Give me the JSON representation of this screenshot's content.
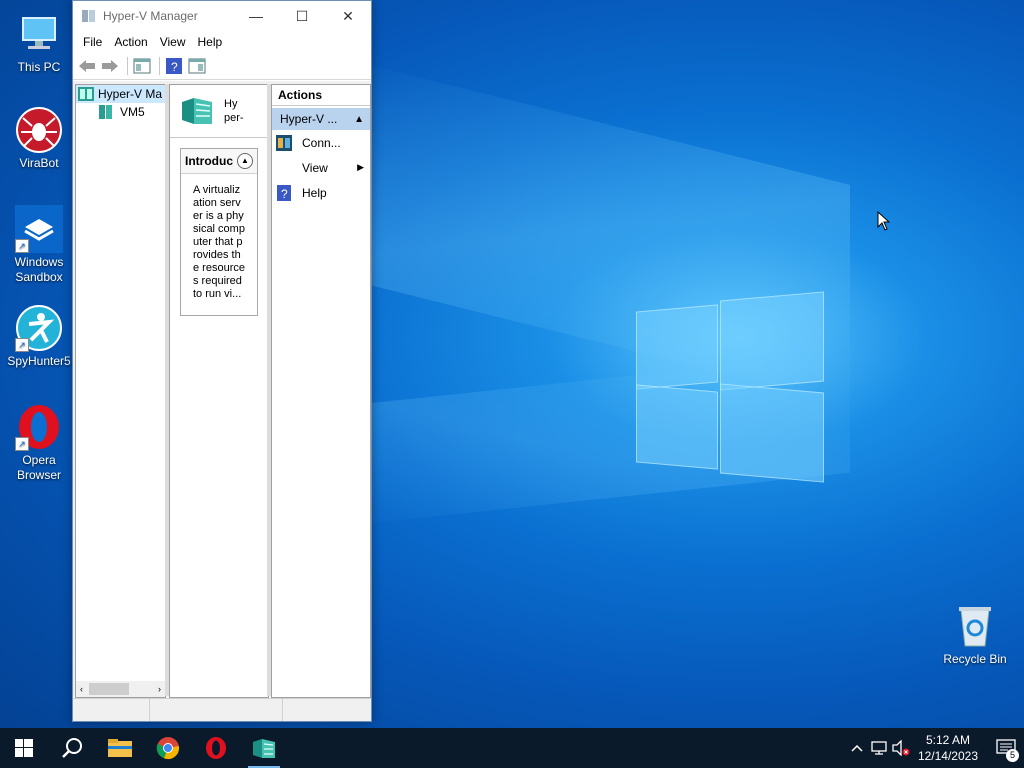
{
  "desktop": {
    "icons": [
      {
        "label": "This PC"
      },
      {
        "label": "ViraBot"
      },
      {
        "label": "Windows Sandbox"
      },
      {
        "label": "SpyHunter5"
      },
      {
        "label": "Opera Browser"
      },
      {
        "label": "Recycle Bin"
      }
    ]
  },
  "window": {
    "title": "Hyper-V Manager",
    "menu": [
      "File",
      "Action",
      "View",
      "Help"
    ],
    "tree": {
      "root": "Hyper-V Ma",
      "child": "VM5"
    },
    "center": {
      "header_line1": "Hy",
      "header_line2": "per-",
      "intro_title": "Introduc",
      "intro_text": "A virtualization server is a physical computer that provides the resources required to run vi..."
    },
    "actions": {
      "header": "Actions",
      "section": "Hyper-V ...",
      "items": [
        {
          "label": "Conn...",
          "icon": "connect-icon"
        },
        {
          "label": "View",
          "icon": "none"
        },
        {
          "label": "Help",
          "icon": "help-icon"
        }
      ]
    }
  },
  "taskbar": {
    "apps": [
      "start",
      "search",
      "file-explorer",
      "chrome",
      "opera",
      "hyper-v-manager"
    ],
    "clock_time": "5:12 AM",
    "clock_date": "12/14/2023",
    "notification_count": "5"
  }
}
